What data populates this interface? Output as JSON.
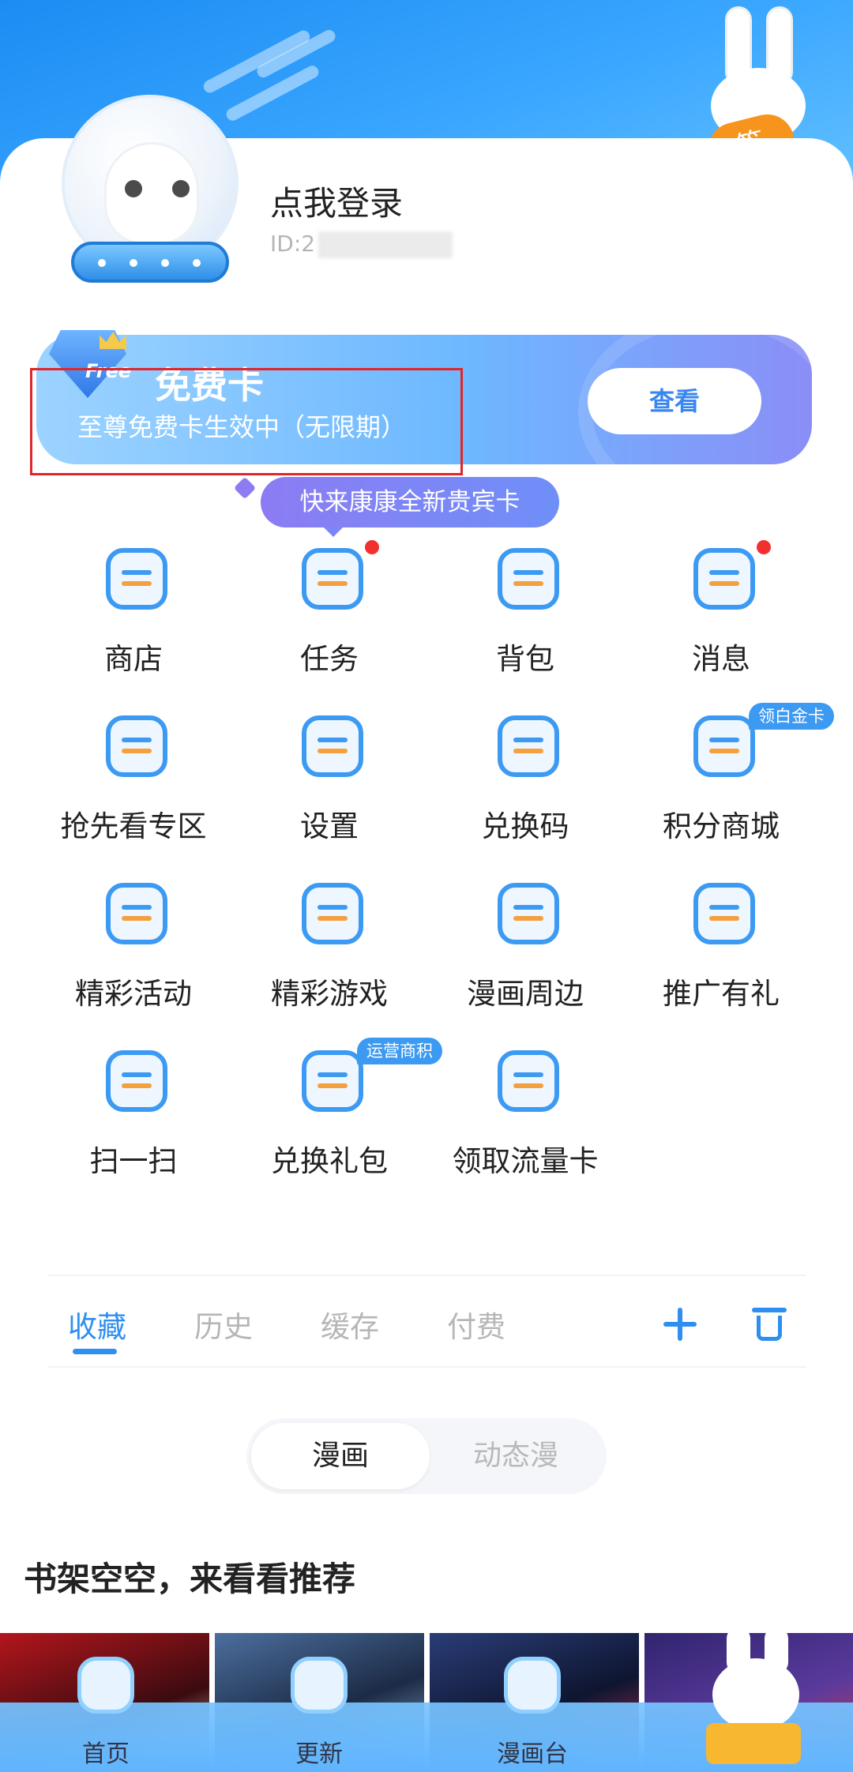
{
  "header": {
    "username": "点我登录",
    "user_id_prefix": "ID:2",
    "sign_badge": "签"
  },
  "free_card": {
    "badge": "Free",
    "title": "免费卡",
    "subtitle": "至尊免费卡生效中（无限期）",
    "button_label": "查看"
  },
  "tooltip": "快来康康全新贵宾卡",
  "grid": [
    {
      "label": "商店",
      "icon": "store-icon"
    },
    {
      "label": "任务",
      "icon": "tasks-icon",
      "dot": true
    },
    {
      "label": "背包",
      "icon": "backpack-icon"
    },
    {
      "label": "消息",
      "icon": "message-icon",
      "dot": true
    },
    {
      "label": "抢先看专区",
      "icon": "preview-ticket-icon"
    },
    {
      "label": "设置",
      "icon": "settings-icon"
    },
    {
      "label": "兑换码",
      "icon": "redeem-code-icon"
    },
    {
      "label": "积分商城",
      "icon": "points-mall-icon",
      "badge": "领白金卡"
    },
    {
      "label": "精彩活动",
      "icon": "star-bag-icon"
    },
    {
      "label": "精彩游戏",
      "icon": "gamepad-icon"
    },
    {
      "label": "漫画周边",
      "icon": "shopping-bag-icon"
    },
    {
      "label": "推广有礼",
      "icon": "heart-envelope-icon"
    },
    {
      "label": "扫一扫",
      "icon": "scan-icon"
    },
    {
      "label": "兑换礼包",
      "icon": "gift-pouch-icon",
      "badge": "运营商积"
    },
    {
      "label": "领取流量卡",
      "icon": "data-ticket-icon"
    }
  ],
  "tabs": {
    "items": [
      "收藏",
      "历史",
      "缓存",
      "付费"
    ],
    "active": "收藏"
  },
  "segment": {
    "options": [
      "漫画",
      "动态漫"
    ],
    "active": "漫画"
  },
  "recommend_title": "书架空空，来看看推荐",
  "bottom_nav": [
    {
      "label": "首页",
      "icon": "home-icon"
    },
    {
      "label": "更新",
      "icon": "update-icon"
    },
    {
      "label": "漫画台",
      "icon": "comic-stage-icon"
    }
  ],
  "colors": {
    "accent": "#2f8ff0",
    "highlight_border": "#e0262b",
    "notification_dot": "#f23030"
  }
}
